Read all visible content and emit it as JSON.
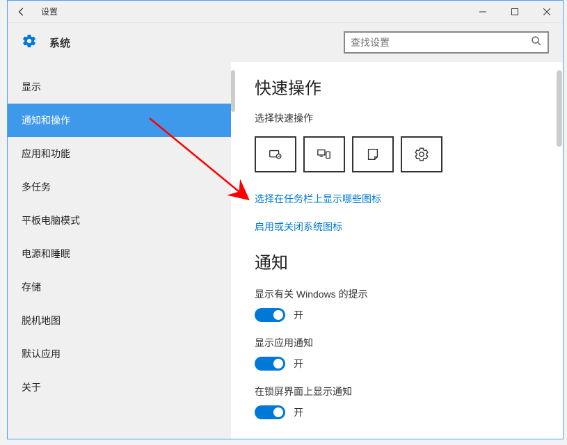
{
  "window": {
    "title": "设置"
  },
  "header": {
    "category": "系统",
    "search_placeholder": "查找设置"
  },
  "sidebar": {
    "items": [
      {
        "label": "显示"
      },
      {
        "label": "通知和操作"
      },
      {
        "label": "应用和功能"
      },
      {
        "label": "多任务"
      },
      {
        "label": "平板电脑模式"
      },
      {
        "label": "电源和睡眠"
      },
      {
        "label": "存储"
      },
      {
        "label": "脱机地图"
      },
      {
        "label": "默认应用"
      },
      {
        "label": "关于"
      }
    ],
    "active_index": 1
  },
  "main": {
    "quick_actions": {
      "title": "快速操作",
      "subtitle": "选择快速操作",
      "tiles": [
        "tablet-mode-icon",
        "connect-icon",
        "note-icon",
        "all-settings-icon"
      ],
      "link1": "选择在任务栏上显示哪些图标",
      "link2": "启用或关闭系统图标"
    },
    "notifications": {
      "title": "通知",
      "settings": [
        {
          "label": "显示有关 Windows 的提示",
          "state": "开"
        },
        {
          "label": "显示应用通知",
          "state": "开"
        },
        {
          "label": "在锁屏界面上显示通知",
          "state": "开"
        }
      ]
    }
  }
}
